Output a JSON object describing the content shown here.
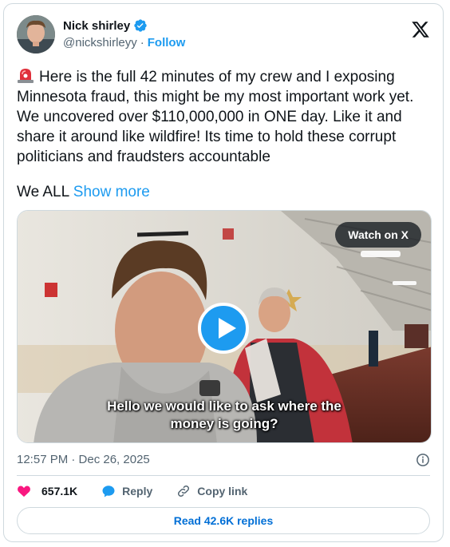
{
  "author": {
    "name": "Nick shirley",
    "handle": "@nickshirleyy",
    "separator": "·",
    "follow_label": "Follow"
  },
  "tweet": {
    "text": "Here is the full 42 minutes of my crew and I exposing Minnesota fraud, this might be my most important work yet. We uncovered over $110,000,000 in ONE day. Like it and share it around like wildfire! Its time to hold these corrupt politicians and fraudsters accountable",
    "text_continued": "We ALL",
    "show_more_label": "Show more"
  },
  "media": {
    "watch_label": "Watch on X",
    "caption_line1": "Hello we would like to ask where the",
    "caption_line2": "money is going?"
  },
  "meta": {
    "timestamp": "12:57 PM · Dec 26, 2025"
  },
  "actions": {
    "likes": "657.1K",
    "reply_label": "Reply",
    "copy_link_label": "Copy link",
    "read_replies_label": "Read 42.6K replies"
  },
  "colors": {
    "accent": "#1d9bf0",
    "like": "#f91880",
    "text": "#0f1419",
    "secondary": "#536471",
    "border": "#cfd9de"
  },
  "icons": [
    "verified-badge-icon",
    "x-logo-icon",
    "siren-emoji-icon",
    "play-icon",
    "info-icon",
    "heart-icon",
    "reply-icon",
    "link-icon"
  ]
}
